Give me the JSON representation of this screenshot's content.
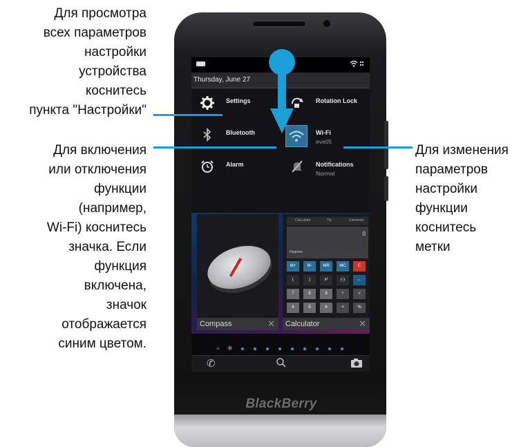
{
  "callouts": {
    "left_top": [
      "Для просмотра",
      "всех параметров",
      "настройки",
      "устройства",
      "коснитесь",
      "пункта \"Настройки\""
    ],
    "left_bottom": [
      "Для включения",
      "или отключения",
      "функции",
      "(например,",
      "Wi-Fi) коснитесь",
      "значка. Если",
      "функция",
      "включена,",
      "значок",
      "отображается",
      "синим цветом."
    ],
    "right": [
      "Для изменения",
      "параметров",
      "настройки",
      "функции",
      "коснитесь",
      "метки"
    ]
  },
  "status_bar": {
    "time": "",
    "date": "Thursday, June 27"
  },
  "quick_settings": {
    "settings": "Settings",
    "rotation_lock": "Rotation Lock",
    "bluetooth": "Bluetooth",
    "wifi": "Wi-Fi",
    "wifi_network": "eve05",
    "alarm": "Alarm",
    "notifications": "Notifications",
    "notifications_mode": "Normal"
  },
  "apps": {
    "compass": "Compass",
    "calculator": "Calculator",
    "calculator_tabs": [
      "Calculator",
      "Tip",
      "Converter"
    ],
    "calculator_display": "0",
    "calculator_mode": "Degrees",
    "calculator_keys": [
      "M+",
      "M-",
      "MR",
      "MC",
      "C",
      "(",
      ")",
      "x²",
      "(-)",
      "←",
      "7",
      "8",
      "9",
      "÷",
      "√",
      "4",
      "5",
      "6",
      "×",
      "%"
    ]
  },
  "brand": "BlackBerry",
  "colors": {
    "accent": "#1a9fd8",
    "wifi_active": "#2f6f93"
  }
}
